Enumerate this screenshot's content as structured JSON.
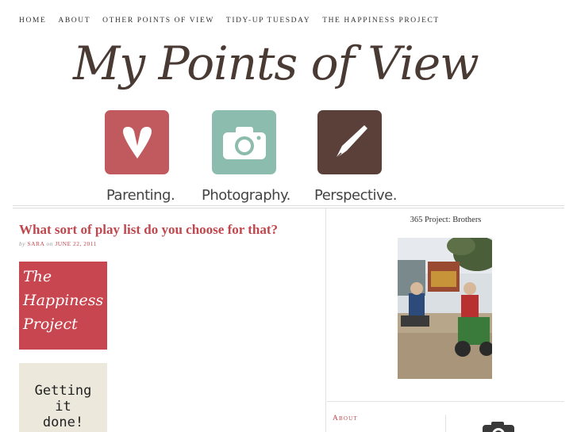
{
  "nav": {
    "items": [
      "HOME",
      "ABOUT",
      "OTHER POINTS OF VIEW",
      "TIDY-UP TUESDAY",
      "THE HAPPINESS PROJECT"
    ]
  },
  "header": {
    "brand": "My Points of View"
  },
  "categories": [
    {
      "label": "Parenting.",
      "icon": "heart-icon",
      "color": "#c05a5e"
    },
    {
      "label": "Photography.",
      "icon": "camera-icon",
      "color": "#8cbcad"
    },
    {
      "label": "Perspective.",
      "icon": "pen-icon",
      "color": "#5a4038"
    }
  ],
  "post": {
    "title": "What sort of play list do you choose for that?",
    "by": "by",
    "author": "SARA",
    "on": "on",
    "date": "JUNE 22, 2011",
    "image1_lines": [
      "The",
      "Happiness",
      "Project"
    ],
    "image2_lines": [
      "Getting",
      "it",
      "done!"
    ]
  },
  "sidebar": {
    "photo_title": "365 Project: Brothers",
    "about_heading": "About"
  },
  "colors": {
    "accent": "#c0474d",
    "brand_text": "#4a3a34"
  }
}
